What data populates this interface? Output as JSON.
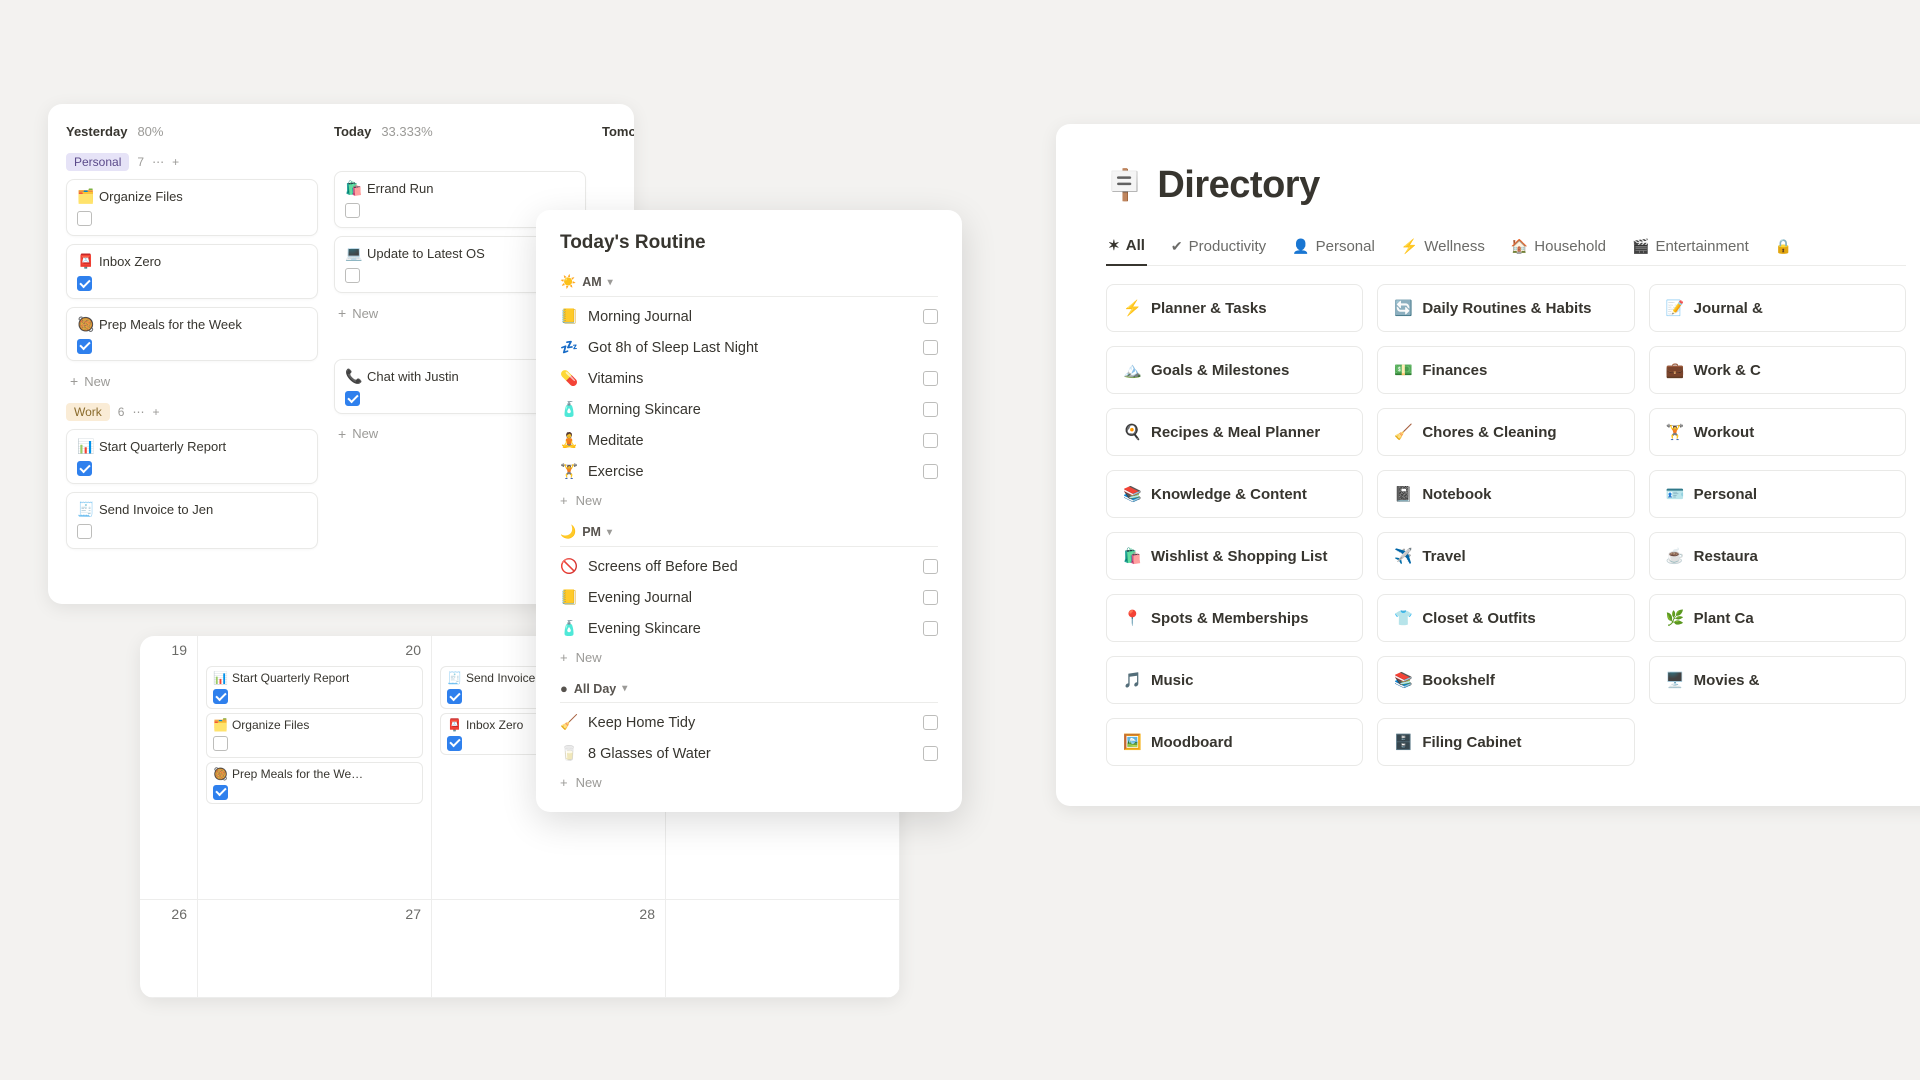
{
  "board": {
    "cols": [
      {
        "title": "Yesterday",
        "pct": "80%"
      },
      {
        "title": "Today",
        "pct": "33.333%"
      },
      {
        "title": "Tomorrow",
        "pct": ""
      }
    ],
    "groups": {
      "personal": {
        "label": "Personal",
        "count": "7"
      },
      "work": {
        "label": "Work",
        "count": "6"
      }
    },
    "new_label": "New",
    "yesterday_personal": [
      {
        "emoji": "🗂️",
        "name": "Organize Files",
        "done": false
      },
      {
        "emoji": "📮",
        "name": "Inbox Zero",
        "done": true
      },
      {
        "emoji": "🥘",
        "name": "Prep Meals for the Week",
        "done": true
      }
    ],
    "today_personal": [
      {
        "emoji": "🛍️",
        "name": "Errand Run",
        "done": false
      },
      {
        "emoji": "💻",
        "name": "Update to Latest OS",
        "done": false
      }
    ],
    "yesterday_work": [
      {
        "emoji": "📊",
        "name": "Start Quarterly Report",
        "done": true
      },
      {
        "emoji": "🧾",
        "name": "Send Invoice to Jen",
        "done": false
      }
    ],
    "today_work": [
      {
        "emoji": "📞",
        "name": "Chat with Justin",
        "done": true
      }
    ]
  },
  "calendar": {
    "row1": {
      "left": "19",
      "c1": "20",
      "c2": "",
      "c3": ""
    },
    "row2": {
      "left": "26",
      "c1": "27",
      "c2": "28",
      "c3": ""
    },
    "events_c1": [
      {
        "emoji": "📊",
        "name": "Start Quarterly Report",
        "done": true
      },
      {
        "emoji": "🗂️",
        "name": "Organize Files",
        "done": false
      },
      {
        "emoji": "🥘",
        "name": "Prep Meals for the We…",
        "done": true
      }
    ],
    "events_c2": [
      {
        "emoji": "🧾",
        "name": "Send Invoice",
        "done": true
      },
      {
        "emoji": "📮",
        "name": "Inbox Zero",
        "done": true
      }
    ]
  },
  "routine": {
    "title": "Today's Routine",
    "sections": {
      "am": {
        "icon": "☀️",
        "label": "AM"
      },
      "pm": {
        "icon": "🌙",
        "label": "PM"
      },
      "allday": {
        "icon": "●",
        "label": "All Day"
      }
    },
    "am_items": [
      {
        "emoji": "📒",
        "label": "Morning Journal"
      },
      {
        "emoji": "💤",
        "label": "Got 8h of Sleep Last Night"
      },
      {
        "emoji": "💊",
        "label": "Vitamins"
      },
      {
        "emoji": "🧴",
        "label": "Morning Skincare"
      },
      {
        "emoji": "🧘",
        "label": "Meditate"
      },
      {
        "emoji": "🏋️",
        "label": "Exercise"
      }
    ],
    "pm_items": [
      {
        "emoji": "🚫",
        "label": "Screens off Before Bed"
      },
      {
        "emoji": "📒",
        "label": "Evening Journal"
      },
      {
        "emoji": "🧴",
        "label": "Evening Skincare"
      }
    ],
    "allday_items": [
      {
        "emoji": "🧹",
        "label": "Keep Home Tidy"
      },
      {
        "emoji": "🥛",
        "label": "8 Glasses of Water"
      }
    ],
    "new_label": "New"
  },
  "directory": {
    "icon": "🪧",
    "title": "Directory",
    "tabs": [
      {
        "icon": "✶",
        "label": "All",
        "active": true
      },
      {
        "icon": "✔",
        "label": "Productivity"
      },
      {
        "icon": "👤",
        "label": "Personal"
      },
      {
        "icon": "⚡",
        "label": "Wellness"
      },
      {
        "icon": "🏠",
        "label": "Household"
      },
      {
        "icon": "🎬",
        "label": "Entertainment"
      },
      {
        "icon": "🔒",
        "label": ""
      }
    ],
    "cards": [
      {
        "icon": "⚡",
        "label": "Planner & Tasks"
      },
      {
        "icon": "🔄",
        "label": "Daily Routines & Habits"
      },
      {
        "icon": "📝",
        "label": "Journal &"
      },
      {
        "icon": "🏔️",
        "label": "Goals & Milestones"
      },
      {
        "icon": "💵",
        "label": "Finances"
      },
      {
        "icon": "💼",
        "label": "Work & C"
      },
      {
        "icon": "🍳",
        "label": "Recipes & Meal Planner"
      },
      {
        "icon": "🧹",
        "label": "Chores & Cleaning"
      },
      {
        "icon": "🏋️",
        "label": "Workout"
      },
      {
        "icon": "📚",
        "label": "Knowledge & Content"
      },
      {
        "icon": "📓",
        "label": "Notebook"
      },
      {
        "icon": "🪪",
        "label": "Personal"
      },
      {
        "icon": "🛍️",
        "label": "Wishlist & Shopping List"
      },
      {
        "icon": "✈️",
        "label": "Travel"
      },
      {
        "icon": "☕",
        "label": "Restaura"
      },
      {
        "icon": "📍",
        "label": "Spots & Memberships"
      },
      {
        "icon": "👕",
        "label": "Closet & Outfits"
      },
      {
        "icon": "🌿",
        "label": "Plant Ca"
      },
      {
        "icon": "🎵",
        "label": "Music"
      },
      {
        "icon": "📚",
        "label": "Bookshelf"
      },
      {
        "icon": "🖥️",
        "label": "Movies &"
      },
      {
        "icon": "🖼️",
        "label": "Moodboard"
      },
      {
        "icon": "🗄️",
        "label": "Filing Cabinet"
      }
    ]
  }
}
